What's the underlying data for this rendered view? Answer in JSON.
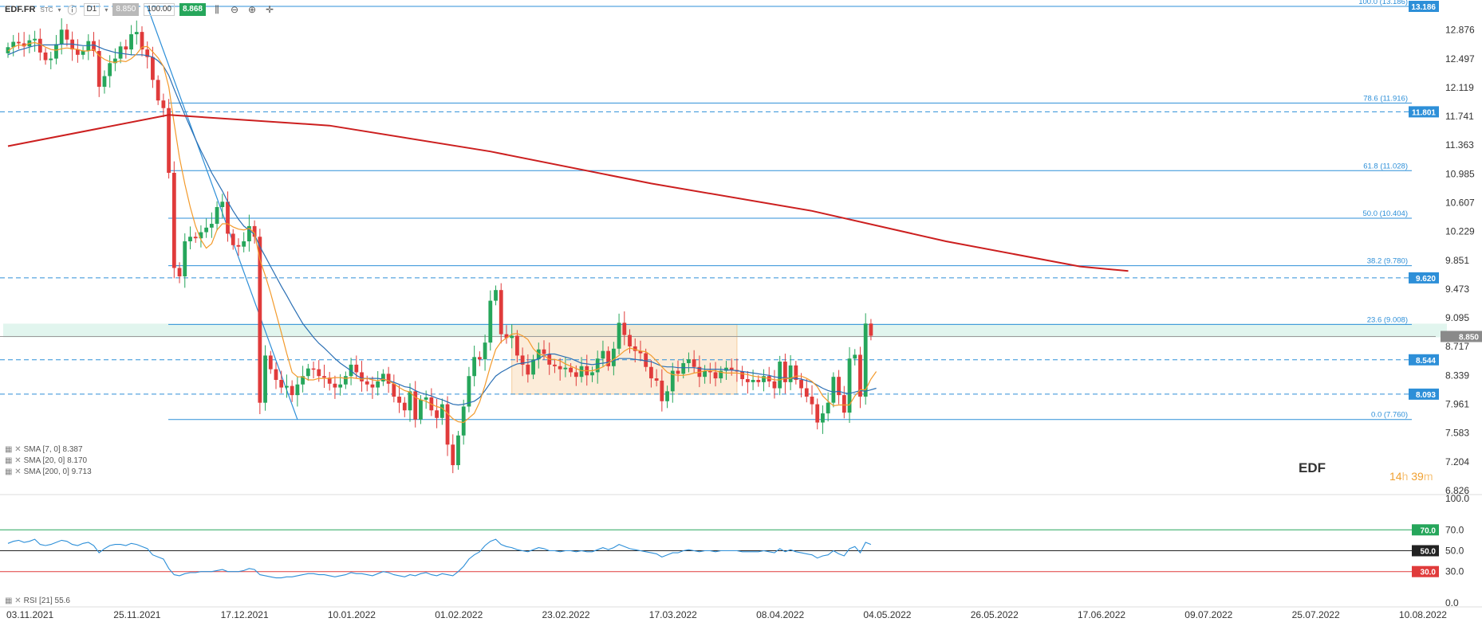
{
  "toolbar": {
    "symbol": "EDF.FR",
    "type": "STC",
    "interval": "D1",
    "bid": "8.850",
    "lots": "100.00",
    "ask": "8.868"
  },
  "instrument_label": "EDF",
  "countdown": {
    "hours": "14",
    "h": "h",
    "minutes": "39",
    "m": "m"
  },
  "price_axis": [
    "12.876",
    "12.497",
    "12.119",
    "11.741",
    "11.363",
    "10.985",
    "10.607",
    "10.229",
    "9.851",
    "9.473",
    "9.095",
    "8.717",
    "8.339",
    "7.961",
    "7.583",
    "7.204",
    "6.826"
  ],
  "rsi_axis": [
    "100.0",
    "70.0",
    "50.0",
    "30.0",
    "0.0"
  ],
  "date_axis": [
    "03.11.2021",
    "25.11.2021",
    "17.12.2021",
    "10.01.2022",
    "01.02.2022",
    "23.02.2022",
    "17.03.2022",
    "08.04.2022",
    "04.05.2022",
    "26.05.2022",
    "17.06.2022",
    "09.07.2022",
    "25.07.2022",
    "10.08.2022"
  ],
  "fib_levels": [
    {
      "label": "100.0 (13.186)",
      "price": 13.186
    },
    {
      "label": "78.6 (11.916)",
      "price": 11.916
    },
    {
      "label": "61.8 (11.028)",
      "price": 11.028
    },
    {
      "label": "50.0 (10.404)",
      "price": 10.404
    },
    {
      "label": "38.2 (9.780)",
      "price": 9.78
    },
    {
      "label": "23.6 (9.008)",
      "price": 9.008
    },
    {
      "label": "0.0 (7.760)",
      "price": 7.76
    }
  ],
  "level_badges": [
    {
      "label": "13.186",
      "price": 13.186,
      "color": "#2d8fd8"
    },
    {
      "label": "11.801",
      "price": 11.801,
      "color": "#2d8fd8"
    },
    {
      "label": "9.620",
      "price": 9.62,
      "color": "#2d8fd8"
    },
    {
      "label": "8.850",
      "price": 8.85,
      "color": "#8a8a8a"
    },
    {
      "label": "8.544",
      "price": 8.544,
      "color": "#2d8fd8"
    },
    {
      "label": "8.093",
      "price": 8.093,
      "color": "#2d8fd8"
    }
  ],
  "rsi_badges": [
    {
      "label": "70.0",
      "value": 70,
      "color": "#26a65b"
    },
    {
      "label": "50.0",
      "value": 50,
      "color": "#222222"
    },
    {
      "label": "30.0",
      "value": 30,
      "color": "#e03b3b"
    }
  ],
  "indicators": [
    {
      "label": "SMA [7, 0] 8.387"
    },
    {
      "label": "SMA [20, 0] 8.170"
    },
    {
      "label": "SMA [200, 0] 9.713"
    }
  ],
  "rsi_indicator": {
    "label": "RSI [21] 55.6"
  },
  "colors": {
    "up": "#26a65b",
    "down": "#e03b3b",
    "sma7": "#f39a2b",
    "sma20": "#2a6fb4",
    "sma200": "#cc1f1f",
    "fib": "#2d8fd8",
    "rsi": "#2d8fd8"
  },
  "chart_data": {
    "type": "candlestick",
    "price_range": [
      6.826,
      13.186
    ],
    "rsi_range": [
      0,
      100
    ],
    "close_series": [
      12.65,
      12.72,
      12.7,
      12.66,
      12.74,
      12.76,
      12.58,
      12.48,
      12.5,
      12.69,
      12.88,
      12.75,
      12.62,
      12.55,
      12.6,
      12.73,
      12.6,
      12.13,
      12.27,
      12.44,
      12.5,
      12.66,
      12.62,
      12.82,
      12.85,
      12.62,
      12.52,
      12.22,
      11.95,
      11.85,
      11.0,
      9.75,
      9.64,
      10.1,
      10.16,
      10.14,
      10.22,
      10.28,
      10.33,
      10.55,
      10.62,
      10.2,
      10.05,
      10.03,
      10.1,
      10.3,
      10.16,
      7.98,
      8.6,
      8.42,
      8.28,
      8.18,
      8.2,
      8.08,
      8.22,
      8.33,
      8.43,
      8.42,
      8.33,
      8.31,
      8.23,
      8.18,
      8.22,
      8.33,
      8.48,
      8.38,
      8.26,
      8.22,
      8.18,
      8.26,
      8.36,
      8.23,
      8.06,
      7.98,
      7.88,
      8.13,
      7.76,
      8.02,
      8.05,
      7.88,
      7.78,
      7.96,
      7.43,
      7.16,
      7.55,
      7.93,
      8.33,
      8.58,
      8.55,
      8.77,
      9.32,
      9.46,
      8.88,
      8.83,
      8.86,
      8.6,
      8.48,
      8.35,
      8.55,
      8.68,
      8.62,
      8.48,
      8.46,
      8.42,
      8.44,
      8.38,
      8.32,
      8.46,
      8.34,
      8.38,
      8.56,
      8.66,
      8.46,
      8.69,
      9.03,
      8.87,
      8.72,
      8.66,
      8.63,
      8.45,
      8.3,
      8.27,
      8.0,
      8.13,
      8.4,
      8.36,
      8.5,
      8.55,
      8.45,
      8.32,
      8.4,
      8.38,
      8.3,
      8.4,
      8.44,
      8.41,
      8.39,
      8.29,
      8.25,
      8.28,
      8.25,
      8.33,
      8.26,
      8.17,
      8.52,
      8.25,
      8.47,
      8.28,
      8.17,
      8.06,
      7.96,
      7.72,
      7.84,
      7.98,
      8.32,
      8.08,
      7.85,
      8.56,
      8.61,
      8.06,
      9.02,
      8.86
    ],
    "sma7": [
      12.6,
      12.65,
      12.68,
      12.67,
      12.7,
      12.71,
      12.69,
      12.65,
      12.62,
      12.61,
      12.63,
      12.64,
      12.63,
      12.62,
      12.6,
      12.6,
      12.62,
      12.54,
      12.49,
      12.46,
      12.45,
      12.47,
      12.46,
      12.5,
      12.56,
      12.65,
      12.66,
      12.59,
      12.51,
      12.4,
      12.13,
      11.65,
      11.2,
      10.85,
      10.55,
      10.3,
      10.12,
      10.01,
      10.07,
      10.25,
      10.33,
      10.33,
      10.29,
      10.26,
      10.25,
      10.27,
      10.21,
      9.86,
      9.65,
      9.42,
      9.16,
      8.9,
      8.63,
      8.38,
      8.32,
      8.32,
      8.28,
      8.28,
      8.3,
      8.3,
      8.3,
      8.31,
      8.31,
      8.3,
      8.31,
      8.3,
      8.29,
      8.3,
      8.28,
      8.27,
      8.29,
      8.27,
      8.23,
      8.18,
      8.14,
      8.12,
      8.05,
      8.02,
      8.0,
      7.96,
      7.93,
      7.91,
      7.84,
      7.77,
      7.73,
      7.72,
      7.78,
      7.84,
      7.99,
      8.21,
      8.46,
      8.68,
      8.78,
      8.83,
      8.88,
      8.89,
      8.86,
      8.81,
      8.69,
      8.62,
      8.6,
      8.55,
      8.55,
      8.53,
      8.49,
      8.46,
      8.43,
      8.4,
      8.4,
      8.4,
      8.42,
      8.45,
      8.5,
      8.55,
      8.6,
      8.66,
      8.7,
      8.68,
      8.66,
      8.65,
      8.6,
      8.53,
      8.45,
      8.38,
      8.35,
      8.34,
      8.34,
      8.35,
      8.37,
      8.38,
      8.4,
      8.4,
      8.4,
      8.38,
      8.37,
      8.37,
      8.37,
      8.36,
      8.35,
      8.33,
      8.32,
      8.31,
      8.3,
      8.28,
      8.28,
      8.3,
      8.3,
      8.33,
      8.33,
      8.3,
      8.26,
      8.19,
      8.07,
      8.0,
      7.94,
      7.95,
      7.95,
      7.95,
      8.07,
      8.15,
      8.15,
      8.29,
      8.39
    ],
    "sma20": [
      12.55,
      12.58,
      12.61,
      12.63,
      12.65,
      12.67,
      12.68,
      12.68,
      12.68,
      12.68,
      12.69,
      12.69,
      12.69,
      12.68,
      12.67,
      12.67,
      12.68,
      12.65,
      12.62,
      12.6,
      12.58,
      12.57,
      12.56,
      12.55,
      12.55,
      12.55,
      12.54,
      12.52,
      12.47,
      12.4,
      12.28,
      12.1,
      11.93,
      11.76,
      11.6,
      11.44,
      11.29,
      11.15,
      11.0,
      10.88,
      10.76,
      10.62,
      10.5,
      10.39,
      10.3,
      10.25,
      10.19,
      10.03,
      9.9,
      9.77,
      9.64,
      9.51,
      9.39,
      9.26,
      9.14,
      9.02,
      8.93,
      8.84,
      8.76,
      8.7,
      8.63,
      8.56,
      8.5,
      8.45,
      8.4,
      8.34,
      8.3,
      8.3,
      8.3,
      8.3,
      8.29,
      8.27,
      8.25,
      8.22,
      8.19,
      8.18,
      8.14,
      8.11,
      8.09,
      8.07,
      8.04,
      8.02,
      7.99,
      7.96,
      7.95,
      7.96,
      7.98,
      8.0,
      8.05,
      8.14,
      8.24,
      8.33,
      8.38,
      8.42,
      8.46,
      8.49,
      8.5,
      8.51,
      8.53,
      8.56,
      8.6,
      8.62,
      8.62,
      8.6,
      8.58,
      8.56,
      8.53,
      8.5,
      8.49,
      8.48,
      8.49,
      8.5,
      8.51,
      8.53,
      8.56,
      8.56,
      8.56,
      8.55,
      8.54,
      8.53,
      8.52,
      8.49,
      8.46,
      8.45,
      8.45,
      8.44,
      8.44,
      8.44,
      8.44,
      8.43,
      8.42,
      8.42,
      8.42,
      8.42,
      8.41,
      8.41,
      8.4,
      8.39,
      8.38,
      8.37,
      8.36,
      8.35,
      8.34,
      8.32,
      8.31,
      8.31,
      8.3,
      8.3,
      8.29,
      8.27,
      8.25,
      8.21,
      8.17,
      8.14,
      8.12,
      8.13,
      8.11,
      8.1,
      8.12,
      8.14,
      8.13,
      8.15,
      8.17
    ],
    "sma200_points": [
      [
        0,
        11.35
      ],
      [
        30,
        11.76
      ],
      [
        60,
        11.62
      ],
      [
        90,
        11.28
      ],
      [
        120,
        10.86
      ],
      [
        150,
        10.5
      ],
      [
        175,
        10.1
      ],
      [
        200,
        9.77
      ],
      [
        209,
        9.71
      ]
    ],
    "rsi_series": [
      57,
      59,
      60,
      58,
      59,
      61,
      56,
      55,
      56,
      58,
      60,
      59,
      56,
      55,
      57,
      58,
      55,
      48,
      52,
      55,
      56,
      56,
      55,
      57,
      56,
      54,
      52,
      46,
      44,
      42,
      33,
      27,
      26,
      28,
      29,
      29,
      30,
      30,
      30,
      31,
      32,
      30,
      30,
      30,
      31,
      33,
      32,
      27,
      26,
      25,
      24,
      24,
      25,
      25,
      26,
      27,
      28,
      28,
      27,
      27,
      26,
      25,
      26,
      27,
      29,
      28,
      28,
      27,
      26,
      28,
      30,
      29,
      27,
      26,
      25,
      27,
      26,
      28,
      29,
      27,
      26,
      28,
      27,
      26,
      30,
      35,
      42,
      46,
      49,
      55,
      59,
      61,
      56,
      54,
      53,
      51,
      50,
      49,
      51,
      53,
      52,
      50,
      50,
      49,
      50,
      50,
      49,
      50,
      49,
      49,
      51,
      53,
      51,
      53,
      56,
      54,
      52,
      51,
      50,
      49,
      48,
      47,
      44,
      46,
      48,
      48,
      50,
      51,
      50,
      49,
      50,
      50,
      49,
      50,
      50,
      50,
      50,
      49,
      49,
      49,
      49,
      50,
      49,
      48,
      52,
      49,
      51,
      49,
      48,
      47,
      46,
      43,
      45,
      46,
      50,
      47,
      45,
      52,
      54,
      48,
      58,
      56
    ],
    "consolidation_box": {
      "x_from": "07.03.2022",
      "x_to": "29.04.2022",
      "y_from": 8.093,
      "y_to": 9.008
    },
    "fib_anchor": {
      "from_price": 13.186,
      "to_price": 7.76
    }
  }
}
